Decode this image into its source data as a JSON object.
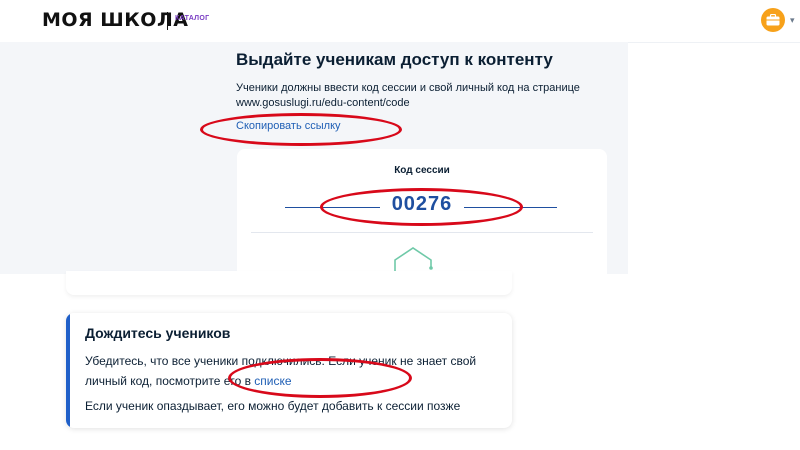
{
  "header": {
    "logo": "МОЯ ШКОЛА",
    "catalog_label": "КАТАЛОГ"
  },
  "access": {
    "title": "Выдайте ученикам доступ к контенту",
    "description_line1": "Ученики должны ввести код сессии и свой личный код на странице",
    "description_line2": "www.gosuslugi.ru/edu-content/code",
    "copy_link": "Скопировать ссылку",
    "session_label": "Код сессии",
    "session_code": "00276"
  },
  "wait": {
    "title": "Дождитесь учеников",
    "text_before_link": "Убедитесь, что все ученики подключились. Если ученик не знает свой личный код, посмотрите его в ",
    "link": "списке",
    "late_text": "Если ученик опаздывает, его можно будет добавить к сессии позже"
  },
  "colors": {
    "accent_blue": "#1f5fc8",
    "link_blue": "#1f5fb5",
    "annotation_red": "#d8091a",
    "avatar_orange": "#f7a11a",
    "catalog_purple": "#7a3dc4"
  },
  "icons": {
    "avatar": "briefcase-icon",
    "dropdown": "chevron-down-icon",
    "qr": "qr-code-icon"
  }
}
